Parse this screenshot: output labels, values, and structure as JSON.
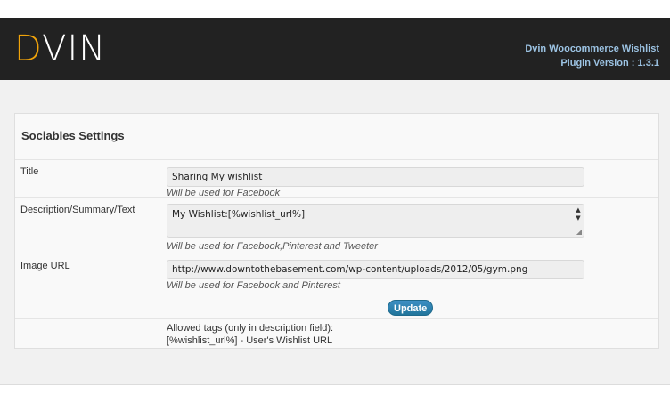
{
  "header": {
    "logo_first_letter": "D",
    "logo_rest": "VIN",
    "plugin_name": "Dvin Woocommerce Wishlist",
    "plugin_version": "Plugin Version : 1.3.1"
  },
  "panel": {
    "title": "Sociables Settings",
    "rows": {
      "title": {
        "label": "Title",
        "value": "Sharing My wishlist",
        "hint": "Will be used for Facebook"
      },
      "description": {
        "label": "Description/Summary/Text",
        "value": "My Wishlist:[%wishlist_url%]",
        "hint": "Will be used for Facebook,Pinterest and Tweeter"
      },
      "image_url": {
        "label": "Image URL",
        "value": "http://www.downtothebasement.com/wp-content/uploads/2012/05/gym.png",
        "hint": "Will be used for Facebook and Pinterest"
      }
    },
    "update_label": "Update",
    "allowed_tags": {
      "heading": "Allowed tags (only in description field):",
      "item": "[%wishlist_url%] - User's Wishlist URL"
    }
  },
  "colors": {
    "header_bg": "#222222",
    "logo_accent": "#f0a30a",
    "header_text": "#9cc3e3",
    "button": "#21759b"
  }
}
